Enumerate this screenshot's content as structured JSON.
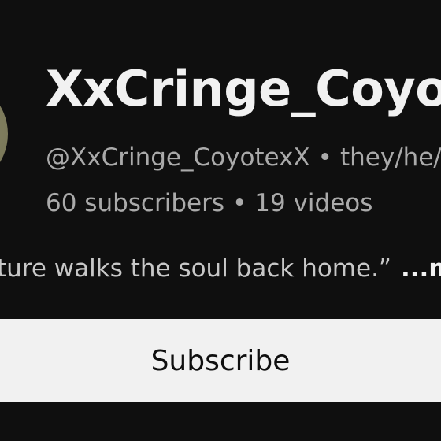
{
  "channel": {
    "name": "XxCringe_CoyotexX",
    "handle": "@XxCringe_CoyotexX",
    "pronouns": "they/he/",
    "separator": "•",
    "subscribers": "60 subscribers",
    "videos": "19 videos"
  },
  "description": {
    "text": "ture walks the soul back home.”",
    "more_label": "...m"
  },
  "actions": {
    "subscribe_label": "Subscribe"
  },
  "colors": {
    "background": "#0f0f0f",
    "primary_text": "#f1f1f1",
    "secondary_text": "#aaaaaa",
    "button_bg": "#f1f1f1",
    "avatar": "#7a7859"
  }
}
